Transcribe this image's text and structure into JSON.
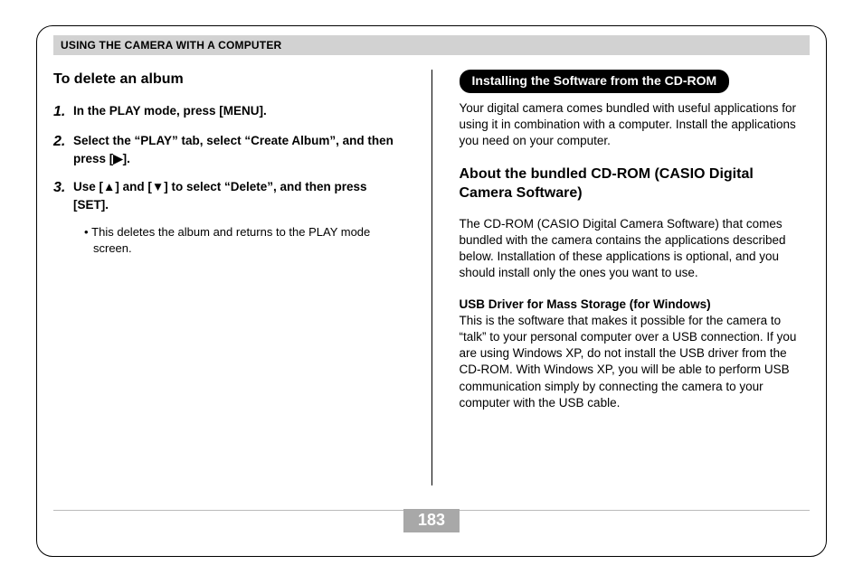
{
  "header": {
    "section_title": "USING THE CAMERA WITH A COMPUTER"
  },
  "left": {
    "heading": "To delete an album",
    "steps": [
      "In the PLAY mode, press [MENU].",
      "Select the “PLAY” tab, select “Create Album”, and then press [▶].",
      "Use [▲] and [▼] to select “Delete”, and then press [SET]."
    ],
    "sub_bullet": "This deletes the album and returns to the PLAY mode screen."
  },
  "right": {
    "pill": "Installing the Software from the CD-ROM",
    "intro": "Your digital camera comes bundled with useful applications for using it in combination with a computer. Install the applications you need on your computer.",
    "heading": "About the bundled CD-ROM (CASIO Digital Camera Software)",
    "body1": "The CD-ROM (CASIO Digital Camera Software) that comes bundled with the camera contains the applications described below. Installation of these applications is optional, and you should install only the ones you want to use.",
    "sub_heading": "USB Driver for Mass Storage (for Windows)",
    "body2": "This is the software that makes it possible for the camera to “talk” to your personal computer over a USB connection. If you are using Windows XP, do not install the USB driver from the CD-ROM. With Windows XP, you will be able to perform USB communication simply by connecting the camera to your computer with the USB cable."
  },
  "page_number": "183"
}
